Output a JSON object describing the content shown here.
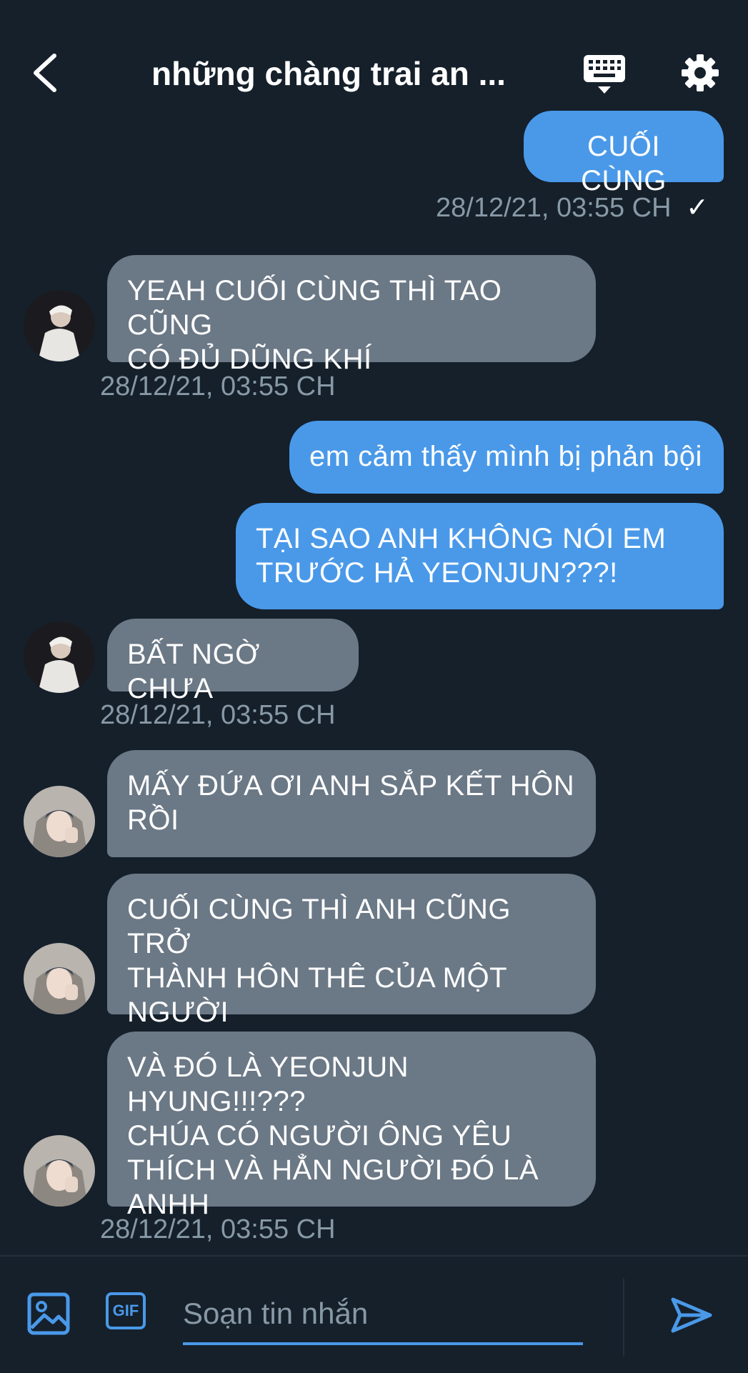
{
  "header": {
    "title": "những chàng trai an ...",
    "back_icon": "chevron-left-icon",
    "keyboard_icon": "keyboard-icon",
    "settings_icon": "gear-icon"
  },
  "messages": [
    {
      "side": "out",
      "text": "CUỐI CÙNG"
    },
    {
      "time": "28/12/21, 03:55 CH",
      "check": "✓"
    },
    {
      "side": "in",
      "text": "YEAH CUỐI CÙNG THÌ TAO CŨNG\nCÓ ĐỦ DŨNG KHÍ"
    },
    {
      "time": "28/12/21, 03:55 CH"
    },
    {
      "side": "out",
      "text": "em cảm thấy mình bị phản bội"
    },
    {
      "side": "out",
      "text": "TẠI SAO ANH KHÔNG NÓI EM\nTRƯỚC HẢ YEONJUN???!"
    },
    {
      "side": "in",
      "text": "BẤT NGỜ CHƯA"
    },
    {
      "time": "28/12/21, 03:55 CH"
    },
    {
      "side": "in",
      "text": "MẤY ĐỨA ƠI ANH SẮP KẾT HÔN\nRỒI"
    },
    {
      "side": "in",
      "text": "CUỐI CÙNG THÌ ANH CŨNG TRỞ\nTHÀNH HÔN THÊ CỦA MỘT\nNGƯỜI"
    },
    {
      "side": "in",
      "text": "VÀ ĐÓ LÀ YEONJUN HYUNG!!!???\nCHÚA CÓ NGƯỜI ÔNG YÊU\nTHÍCH VÀ HẲN NGƯỜI ĐÓ LÀ\nANHH"
    },
    {
      "time": "28/12/21, 03:55 CH"
    }
  ],
  "composer": {
    "placeholder": "Soạn tin nhắn",
    "gif_label": "GIF",
    "image_icon": "image-icon",
    "send_icon": "send-icon"
  },
  "colors": {
    "background": "#15202b",
    "outgoing_bubble": "#4a99e9",
    "incoming_bubble": "#6b7886",
    "timestamp": "#8899a6",
    "accent": "#4a99e9"
  }
}
